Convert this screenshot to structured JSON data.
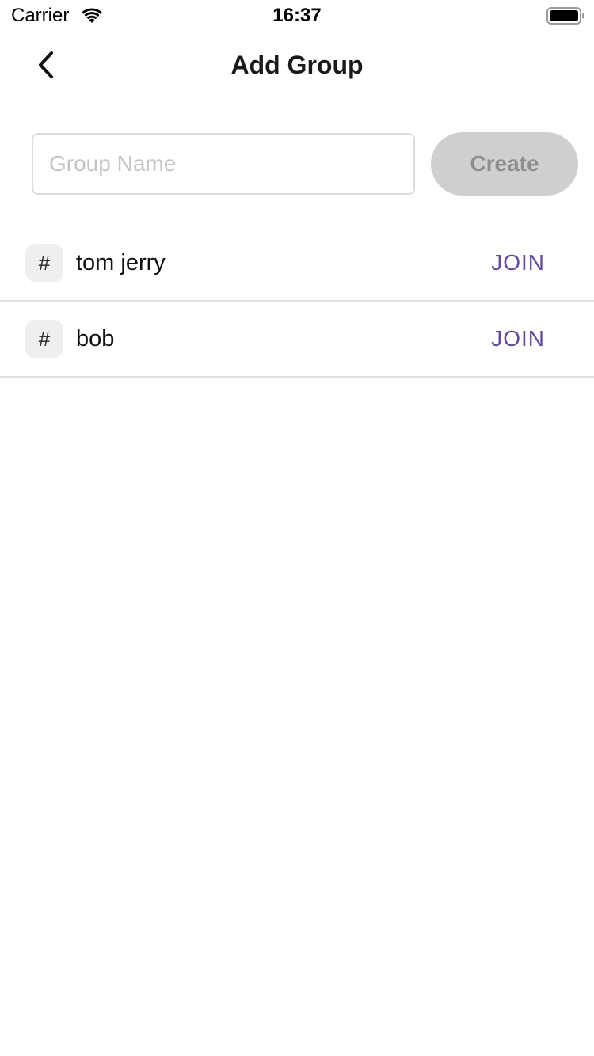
{
  "status_bar": {
    "carrier": "Carrier",
    "time": "16:37"
  },
  "header": {
    "title": "Add Group",
    "back_icon": "chevron-left-icon"
  },
  "create_form": {
    "input_value": "",
    "input_placeholder": "Group Name",
    "create_label": "Create"
  },
  "groups": [
    {
      "icon": "#",
      "name": "tom jerry",
      "action_label": "JOIN"
    },
    {
      "icon": "#",
      "name": "bob",
      "action_label": "JOIN"
    }
  ],
  "colors": {
    "accent": "#634a9e",
    "disabled_button_bg": "#cfcfcf",
    "disabled_button_text": "#8e8e8e",
    "divider": "#e2e2e2"
  }
}
